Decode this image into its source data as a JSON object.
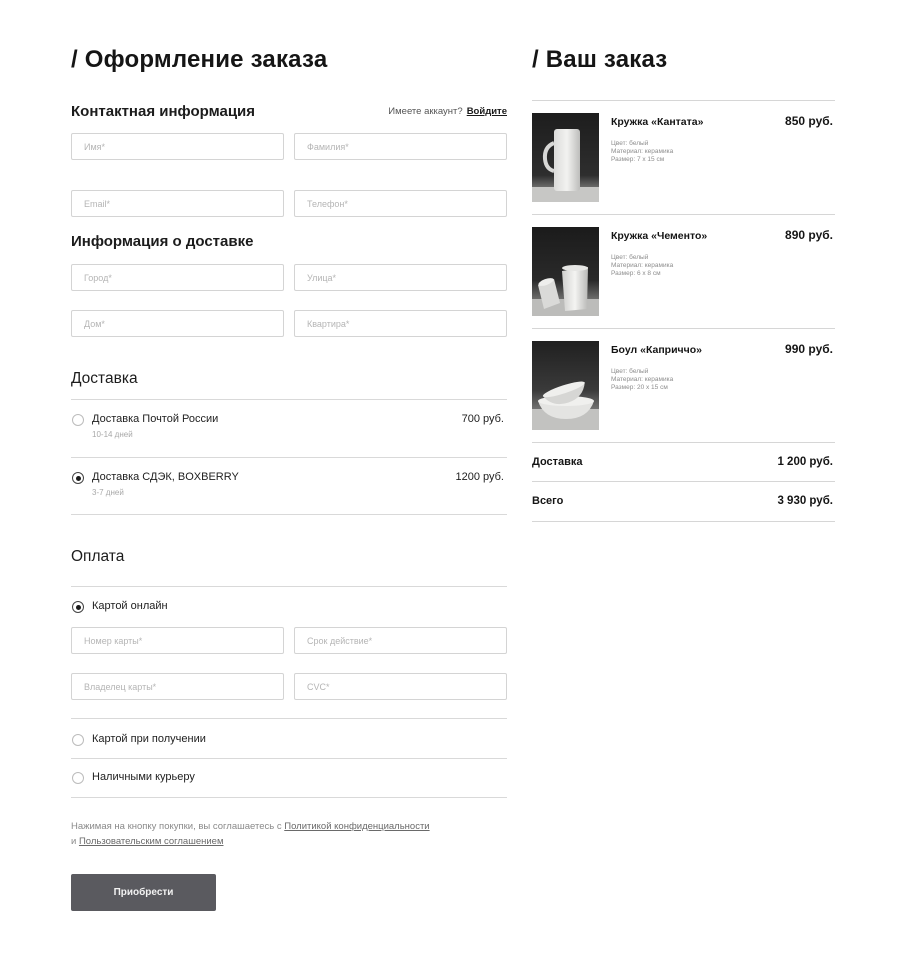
{
  "checkout": {
    "title": "/ Оформление заказа",
    "contact": {
      "heading": "Контактная информация",
      "account_question": "Имеете аккаунт?",
      "login_link": "Войдите",
      "first_name_placeholder": "Имя*",
      "last_name_placeholder": "Фамилия*",
      "email_placeholder": "Email*",
      "phone_placeholder": "Телефон*"
    },
    "address": {
      "heading": "Информация о доставке",
      "city_placeholder": "Город*",
      "street_placeholder": "Улица*",
      "house_placeholder": "Дом*",
      "apartment_placeholder": "Квартира*"
    },
    "delivery": {
      "heading": "Доставка",
      "options": [
        {
          "label": "Доставка Почтой России",
          "sub": "10-14 дней",
          "price": "700 руб.",
          "selected": false
        },
        {
          "label": "Доставка СДЭК, BOXBERRY",
          "sub": "3-7 дней",
          "price": "1200 руб.",
          "selected": true
        }
      ]
    },
    "payment": {
      "heading": "Оплата",
      "options": [
        {
          "label": "Картой онлайн",
          "selected": true
        },
        {
          "label": "Картой при получении",
          "selected": false
        },
        {
          "label": "Наличными курьеру",
          "selected": false
        }
      ],
      "card_number_placeholder": "Номер карты*",
      "expiry_placeholder": "Срок действие*",
      "holder_placeholder": "Владелец карты*",
      "cvc_placeholder": "CVC*"
    },
    "terms": {
      "prefix": "Нажимая на кнопку покупки, вы соглашаетесь с ",
      "privacy_link": "Политикой конфиденциальности",
      "and": "и ",
      "agreement_link": "Пользовательским соглашением"
    },
    "buy_label": "Приобрести"
  },
  "order": {
    "title": "/ Ваш заказ",
    "items": [
      {
        "name": "Кружка «Кантата»",
        "price": "850 руб.",
        "color": "Цвет: белый",
        "material": "Материал: керамика",
        "size": "Размер: 7 х 15 см"
      },
      {
        "name": "Кружка «Чементо»",
        "price": "890 руб.",
        "color": "Цвет: белый",
        "material": "Материал: керамика",
        "size": "Размер: 6 х 8 см"
      },
      {
        "name": "Боул «Каприччо»",
        "price": "990 руб.",
        "color": "Цвет: белый",
        "material": "Материал: керамика",
        "size": "Размер: 20 х 15 см"
      }
    ],
    "delivery_label": "Доставка",
    "delivery_value": "1 200 руб.",
    "total_label": "Всего",
    "total_value": "3 930 руб."
  },
  "colors": {
    "button_bg": "#5a5a5f",
    "text": "#1a1a1a",
    "border": "#d4d4d4",
    "placeholder": "#b5b5b5"
  },
  "icons": [
    "radio-unchecked-icon",
    "radio-checked-icon"
  ]
}
